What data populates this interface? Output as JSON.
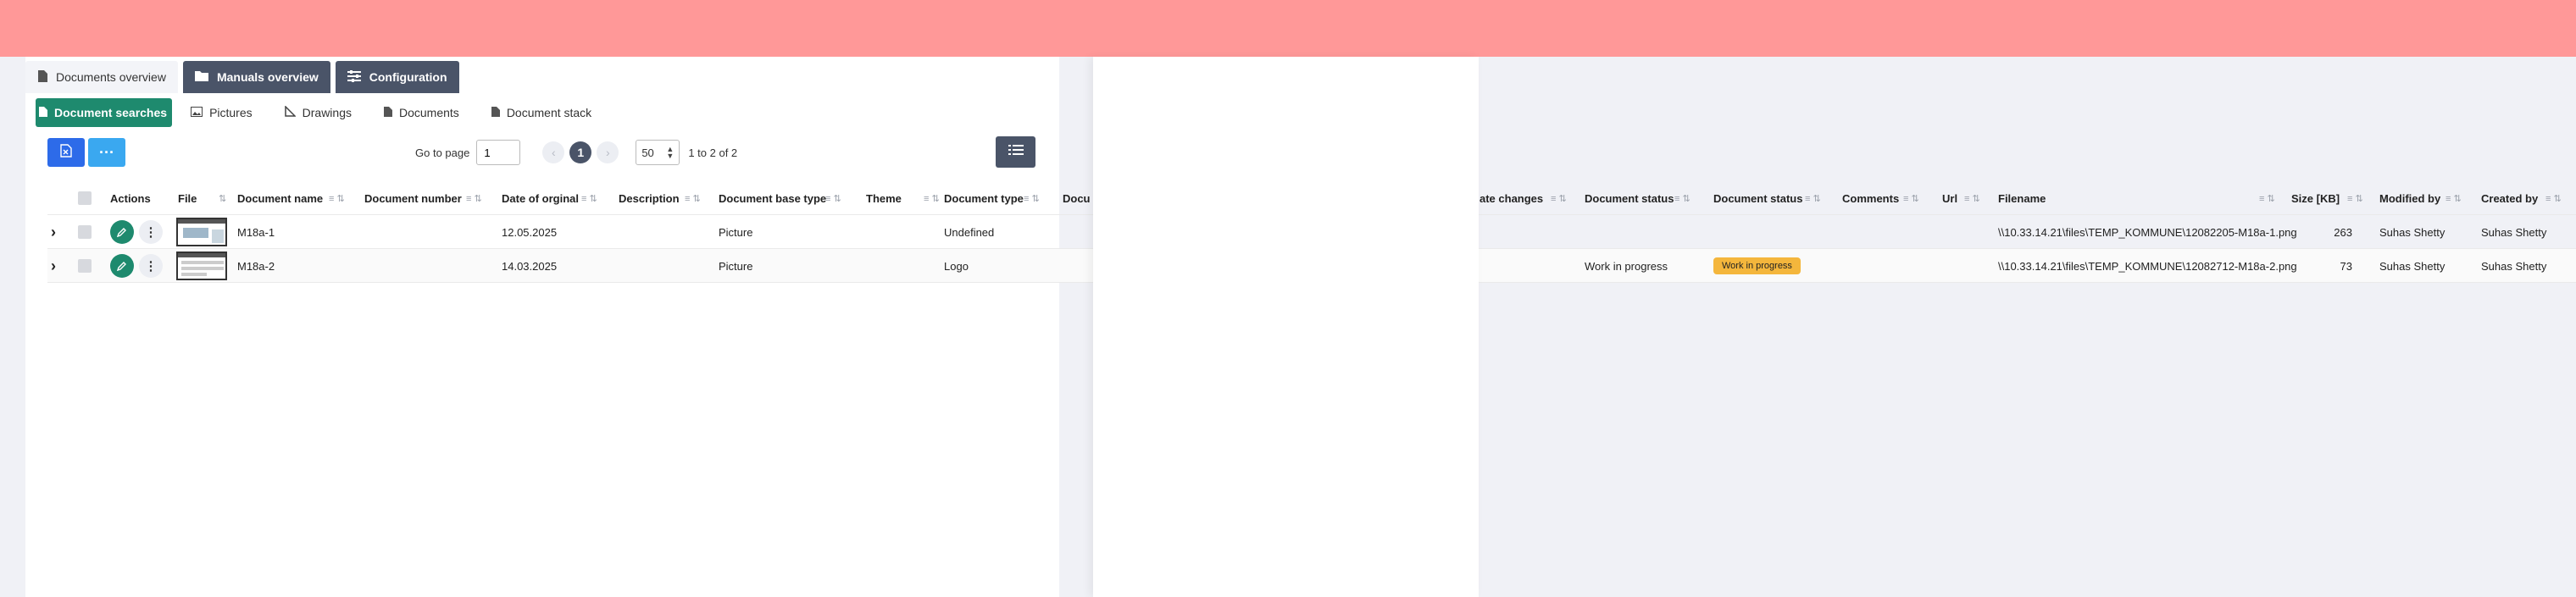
{
  "top_tabs": [
    {
      "label": "Documents overview",
      "icon": "document-icon"
    },
    {
      "label": "Manuals overview",
      "icon": "folder-icon"
    },
    {
      "label": "Configuration",
      "icon": "sliders-icon"
    }
  ],
  "sub_tabs": [
    {
      "label": "Document searches",
      "icon": "document-icon"
    },
    {
      "label": "Pictures",
      "icon": "image-icon"
    },
    {
      "label": "Drawings",
      "icon": "ruler-icon"
    },
    {
      "label": "Documents",
      "icon": "document-icon"
    },
    {
      "label": "Document stack",
      "icon": "document-icon"
    }
  ],
  "toolbar": {
    "export_icon": "excel-export-icon",
    "more_label": "···"
  },
  "pagination": {
    "go_to_label": "Go to page",
    "page_value": "1",
    "current_page": "1",
    "page_size": "50",
    "range_text": "1 to 2 of 2"
  },
  "columns": {
    "actions": "Actions",
    "file": "File",
    "doc_name": "Document name",
    "doc_number": "Document number",
    "date_original": "Date of orginal",
    "description": "Description",
    "base_type": "Document base type",
    "theme": "Theme",
    "doc_type": "Document type",
    "docu_partial": "Docu",
    "date_changes_partial": "ate changes",
    "doc_status_1": "Document status",
    "doc_status_2": "Document status",
    "comments": "Comments",
    "url": "Url",
    "filename": "Filename",
    "size": "Size [KB]",
    "modified_by": "Modified by",
    "created_by": "Created by"
  },
  "rows": [
    {
      "doc_name": "M18a-1",
      "date_original": "12.05.2025",
      "base_type": "Picture",
      "doc_type": "Undefined",
      "doc_status_text": "",
      "doc_status_badge": "",
      "filename": "\\\\10.33.14.21\\files\\TEMP_KOMMUNE\\12082205-M18a-1.png",
      "size": "263",
      "modified_by": "Suhas Shetty",
      "created_by": "Suhas Shetty"
    },
    {
      "doc_name": "M18a-2",
      "date_original": "14.03.2025",
      "base_type": "Picture",
      "doc_type": "Logo",
      "doc_status_text": "Work in progress",
      "doc_status_badge": "Work in progress",
      "filename": "\\\\10.33.14.21\\files\\TEMP_KOMMUNE\\12082712-M18a-2.png",
      "size": "73",
      "modified_by": "Suhas Shetty",
      "created_by": "Suhas Shetty"
    }
  ],
  "colors": {
    "topbar": "#ff9898",
    "accent_green": "#1e8a6e",
    "dark_slate": "#4a5468",
    "export_blue": "#2d6be9",
    "more_blue": "#3aa8f0",
    "badge_orange": "#f4b63c"
  }
}
